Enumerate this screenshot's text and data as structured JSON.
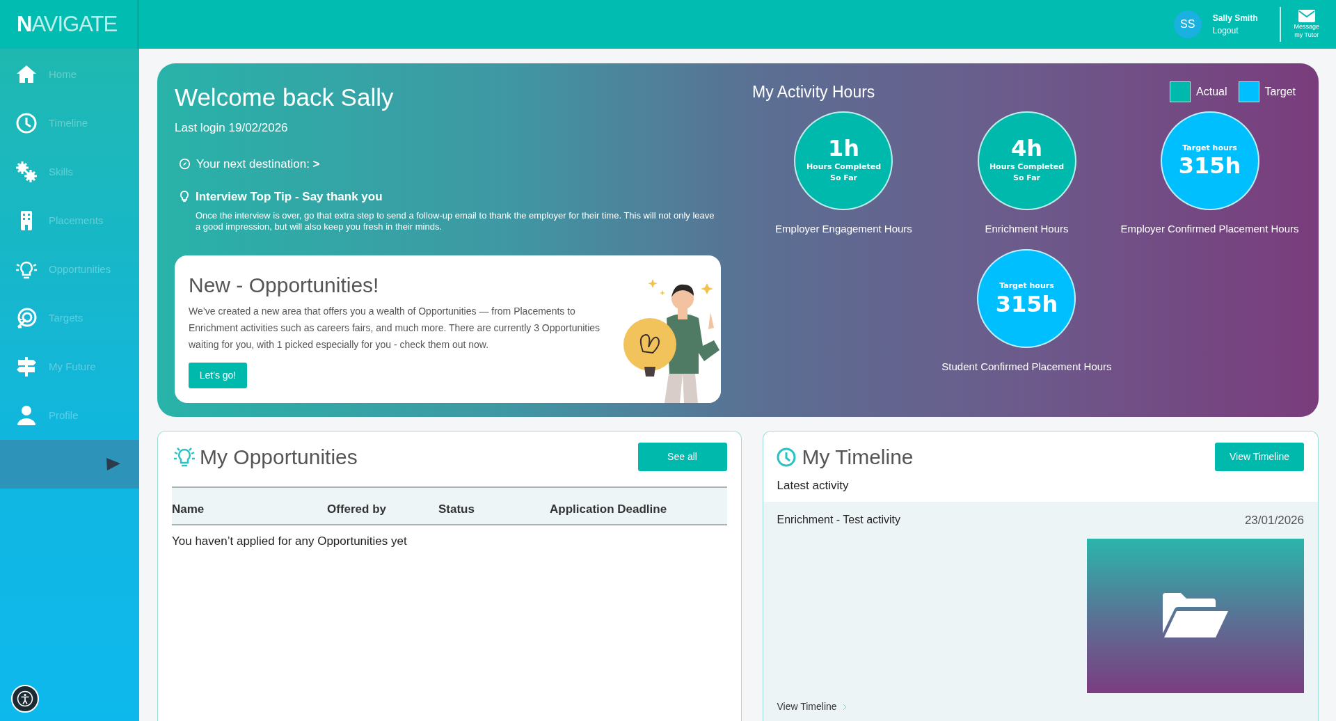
{
  "logo": "**N**AVIGATE",
  "user": {
    "initials": "SS",
    "name": "Sally Smith",
    "logout": "Logout"
  },
  "message_button": {
    "line1": "Message",
    "line2": "my Tutor"
  },
  "sidebar": {
    "items": [
      {
        "label": "Home",
        "kind": "home"
      },
      {
        "label": "Timeline",
        "kind": "clock"
      },
      {
        "label": "Skills",
        "kind": "gears"
      },
      {
        "label": "Placements",
        "kind": "building"
      },
      {
        "label": "Opportunities",
        "kind": "bulb"
      },
      {
        "label": "Targets",
        "kind": "target"
      },
      {
        "label": "My Future",
        "kind": "sign"
      },
      {
        "label": "Profile",
        "kind": "person"
      }
    ]
  },
  "welcome": {
    "title": "Welcome back Sally",
    "last_login": "Last login 19/02/2026",
    "destination": "Your next destination: **>**",
    "tip_title": "Interview Top Tip - Say thank you",
    "tip_text": "Once the interview is over, go that extra step to send a follow-up email to thank the employer for their time. This will not only leave a good impression, but will also keep you fresh in their minds.",
    "promo": {
      "title": "New - Opportunities!",
      "text": "We’ve created a new area that offers you a wealth of Opportunities — from Placements to Enrichment activities such as careers fairs, and much more. There are currently 3 Opportunities waiting for you, with 1 picked especially for you - check them out now.",
      "button": "Let's go!"
    }
  },
  "activity": {
    "title": "My Activity Hours",
    "legend": [
      {
        "label": "Actual",
        "color": "#00b9ad"
      },
      {
        "label": "Target",
        "color": "#00bfff"
      }
    ],
    "circles": [
      {
        "kind": "actual",
        "value": "1h",
        "line1": "Hours Completed",
        "line2": "So Far",
        "label": "Employer Engagement Hours"
      },
      {
        "kind": "actual",
        "value": "4h",
        "line1": "Hours Completed",
        "line2": "So Far",
        "label": "Enrichment Hours"
      },
      {
        "kind": "target",
        "caption": "Target hours",
        "value": "315h",
        "label": "Employer Confirmed Placement Hours"
      },
      {
        "kind": "target",
        "caption": "Target hours",
        "value": "315h",
        "label": "Student Confirmed Placement Hours"
      }
    ]
  },
  "opportunities": {
    "title": "My Opportunities",
    "button": "See all",
    "columns": [
      "Name",
      "Offered by",
      "Status",
      "Application Deadline"
    ],
    "empty": "You haven’t applied for any Opportunities yet"
  },
  "timeline": {
    "title": "My Timeline",
    "button": "View Timeline",
    "subtitle": "Latest activity",
    "entry": {
      "title": "Enrichment - Test activity",
      "date": "23/01/2026"
    },
    "link": "View Timeline"
  }
}
